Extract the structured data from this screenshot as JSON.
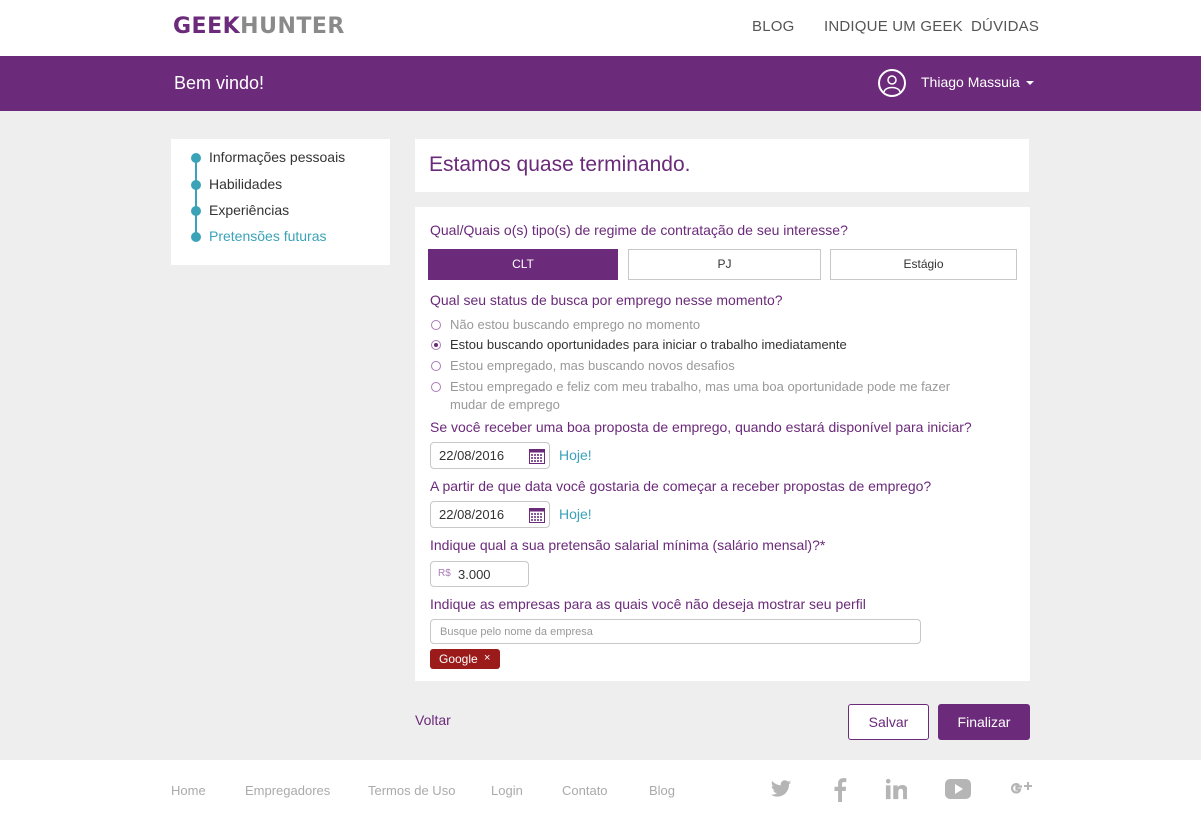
{
  "brand": {
    "part1": "GEEK",
    "part2": "HUNTER"
  },
  "topnav": {
    "blog": "BLOG",
    "indique": "INDIQUE UM GEEK",
    "duvidas": "DÚVIDAS"
  },
  "header": {
    "welcome": "Bem vindo!",
    "user_name": "Thiago Massuia"
  },
  "steps": [
    {
      "label": "Informações pessoais"
    },
    {
      "label": "Habilidades"
    },
    {
      "label": "Experiências"
    },
    {
      "label": "Pretensões futuras"
    }
  ],
  "form": {
    "title": "Estamos quase terminando.",
    "q_regime": "Qual/Quais o(s) tipo(s) de regime de contratação de seu interesse?",
    "regime_options": [
      "CLT",
      "PJ",
      "Estágio"
    ],
    "regime_selected": "CLT",
    "q_status": "Qual seu status de busca por emprego nesse momento?",
    "status_options": [
      "Não estou buscando emprego no momento",
      "Estou buscando oportunidades para iniciar o trabalho imediatamente",
      "Estou empregado, mas buscando novos desafios",
      "Estou empregado e feliz com meu trabalho, mas uma boa oportunidade pode me fazer mudar de emprego"
    ],
    "status_selected": "Estou buscando oportunidades para iniciar o trabalho imediatamente",
    "q_disponivel": "Se você receber uma boa proposta de emprego, quando estará disponível para iniciar?",
    "date_disponivel": "22/08/2016",
    "hoje_label": "Hoje!",
    "q_propostas": "A partir de que data você gostaria de começar a receber propostas de emprego?",
    "date_propostas": "22/08/2016",
    "q_salario": "Indique qual a sua pretensão salarial mínima (salário mensal)?*",
    "currency": "R$",
    "salario": "3.000",
    "q_empresas": "Indique as empresas para as quais você não deseja mostrar seu perfil",
    "empresa_placeholder": "Busque pelo nome da empresa",
    "blocked_companies": [
      "Google"
    ],
    "tag_remove": "×"
  },
  "actions": {
    "voltar": "Voltar",
    "salvar": "Salvar",
    "finalizar": "Finalizar"
  },
  "footer": {
    "links": [
      "Home",
      "Empregadores",
      "Termos de Uso",
      "Login",
      "Contato",
      "Blog"
    ],
    "social_icons": [
      "twitter-icon",
      "facebook-icon",
      "linkedin-icon",
      "youtube-icon",
      "google-plus-icon"
    ]
  },
  "colors": {
    "brand_purple": "#6b2a7a",
    "accent_teal": "#3aa3b8",
    "tag_red": "#9b1b1b",
    "page_bg": "#eeeeee"
  }
}
